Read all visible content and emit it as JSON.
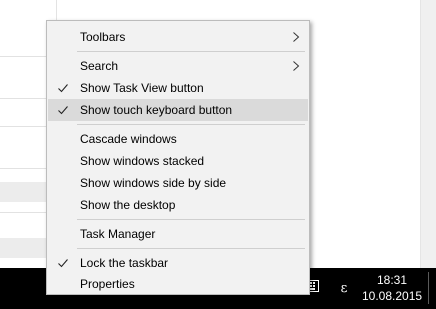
{
  "context_menu": {
    "items": [
      {
        "label": "Toolbars",
        "submenu": true,
        "checked": false
      },
      {
        "label": "Search",
        "submenu": true,
        "checked": false
      },
      {
        "label": "Show Task View button",
        "submenu": false,
        "checked": true
      },
      {
        "label": "Show touch keyboard button",
        "submenu": false,
        "checked": true,
        "highlighted": true
      },
      {
        "label": "Cascade windows",
        "submenu": false,
        "checked": false
      },
      {
        "label": "Show windows stacked",
        "submenu": false,
        "checked": false
      },
      {
        "label": "Show windows side by side",
        "submenu": false,
        "checked": false
      },
      {
        "label": "Show the desktop",
        "submenu": false,
        "checked": false
      },
      {
        "label": "Task Manager",
        "submenu": false,
        "checked": false
      },
      {
        "label": "Lock the taskbar",
        "submenu": false,
        "checked": true
      },
      {
        "label": "Properties",
        "submenu": false,
        "checked": false
      }
    ],
    "icons": {
      "check": "checkmark-icon",
      "submenu": "chevron-right-icon"
    }
  },
  "taskbar": {
    "tray": {
      "keyboard_icon": "touch-keyboard-icon",
      "input_indicator": "ε",
      "time": "18:31",
      "date": "10.08.2015"
    }
  },
  "colors": {
    "taskbar_bg": "#000000",
    "menu_bg": "#f2f2f2",
    "menu_highlight": "#dadada",
    "menu_border": "#bcbcbc"
  }
}
